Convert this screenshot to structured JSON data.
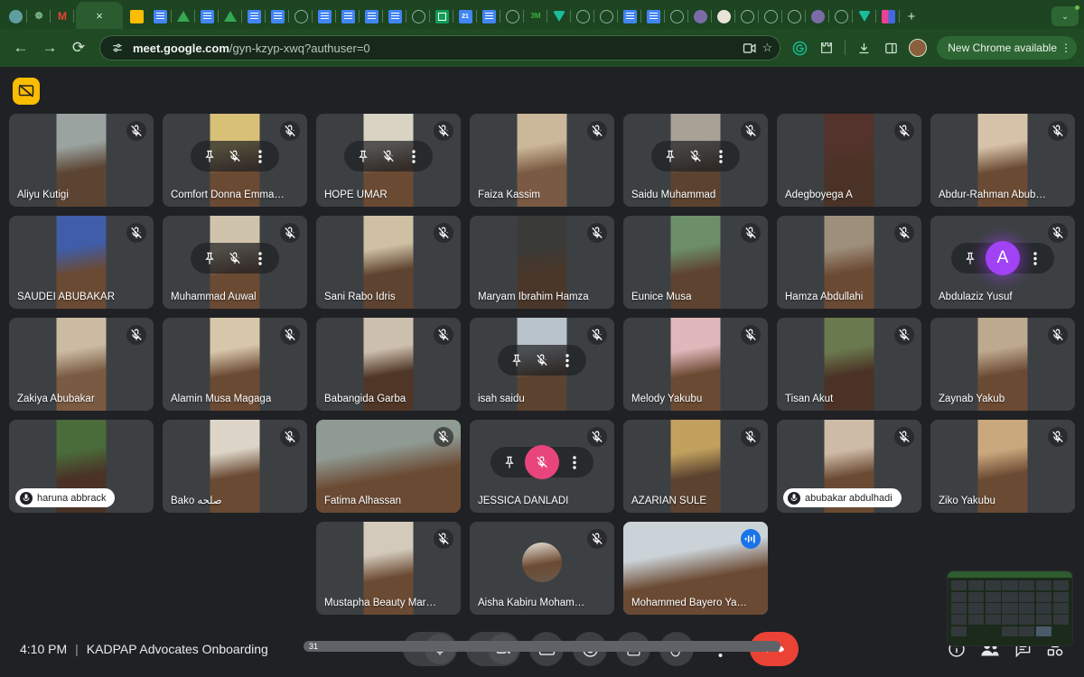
{
  "browser": {
    "url_domain": "meet.google.com",
    "url_path": "/gyn-kzyp-xwq?authuser=0",
    "tab_close_label": "×",
    "new_tab_label": "+",
    "back_label": "←",
    "forward_label": "→",
    "reload_label": "⟳",
    "update_chip_label": "New Chrome available",
    "update_chip_menu": "⋮",
    "tabs": [
      {
        "name": "tab-favicon-blue-diamond",
        "kind": "fv-blue-circle"
      },
      {
        "name": "tab-favicon-shield",
        "kind": "fv-shield",
        "glyph": "☸"
      },
      {
        "name": "tab-favicon-gmail",
        "kind": "fv-gmail",
        "glyph": "M"
      },
      {
        "name": "tab-favicon-meet",
        "kind": "fv-meet"
      },
      {
        "name": "tab-favicon-docs-1",
        "kind": "fv-doc"
      },
      {
        "name": "tab-favicon-drive-1",
        "kind": "fv-drive"
      },
      {
        "name": "tab-favicon-docs-2",
        "kind": "fv-doc"
      },
      {
        "name": "tab-favicon-drive-2",
        "kind": "fv-drive"
      },
      {
        "name": "tab-favicon-docs-3",
        "kind": "fv-doc"
      },
      {
        "name": "tab-favicon-docs-4",
        "kind": "fv-doc"
      },
      {
        "name": "tab-favicon-circle-1",
        "kind": "fv-circle"
      },
      {
        "name": "tab-favicon-docs-5",
        "kind": "fv-doc"
      },
      {
        "name": "tab-favicon-docs-6",
        "kind": "fv-doc"
      },
      {
        "name": "tab-favicon-docs-7",
        "kind": "fv-doc"
      },
      {
        "name": "tab-favicon-docs-8",
        "kind": "fv-doc"
      },
      {
        "name": "tab-favicon-circle-2",
        "kind": "fv-circle"
      },
      {
        "name": "tab-favicon-sheets",
        "kind": "fv-sheet"
      },
      {
        "name": "tab-favicon-calendar",
        "kind": "fv-cal",
        "glyph": "21"
      },
      {
        "name": "tab-favicon-docs-9",
        "kind": "fv-doc"
      },
      {
        "name": "tab-favicon-circle-3",
        "kind": "fv-circle"
      },
      {
        "name": "tab-favicon-3m",
        "kind": "fv-3m",
        "glyph": "3M"
      },
      {
        "name": "tab-favicon-tri-teal",
        "kind": "fv-tri-teal"
      },
      {
        "name": "tab-favicon-circle-4",
        "kind": "fv-circle"
      },
      {
        "name": "tab-favicon-circle-5",
        "kind": "fv-circle"
      },
      {
        "name": "tab-favicon-docs-10",
        "kind": "fv-doc"
      },
      {
        "name": "tab-favicon-docs-11",
        "kind": "fv-doc"
      },
      {
        "name": "tab-favicon-circle-6",
        "kind": "fv-circle"
      },
      {
        "name": "tab-favicon-purple-1",
        "kind": "fv-purple"
      },
      {
        "name": "tab-favicon-white-circle",
        "kind": "fv-white-circle"
      },
      {
        "name": "tab-favicon-circle-7",
        "kind": "fv-circle"
      },
      {
        "name": "tab-favicon-circle-8",
        "kind": "fv-circle"
      },
      {
        "name": "tab-favicon-circle-9",
        "kind": "fv-circle"
      },
      {
        "name": "tab-favicon-purple-2",
        "kind": "fv-purple"
      },
      {
        "name": "tab-favicon-circle-10",
        "kind": "fv-circle"
      },
      {
        "name": "tab-favicon-tri-teal-2",
        "kind": "fv-tri-teal"
      },
      {
        "name": "tab-favicon-pink",
        "kind": "fv-pink"
      }
    ]
  },
  "meet": {
    "present_button_icon": "stop-presenting-icon",
    "time": "4:10 PM",
    "separator": "|",
    "meeting_name": "KADPAP Advocates Onboarding",
    "participant_count": "31",
    "controls": [
      {
        "name": "microphone-toggle",
        "icon": "mic-icon",
        "chevron": "⌃"
      },
      {
        "name": "camera-toggle",
        "icon": "camera-icon",
        "chevron": "⌃"
      },
      {
        "name": "captions-toggle",
        "icon": "cc-icon"
      },
      {
        "name": "reactions-button",
        "icon": "emoji-icon"
      },
      {
        "name": "present-now-button",
        "icon": "present-icon"
      },
      {
        "name": "raise-hand-button",
        "icon": "hand-icon"
      },
      {
        "name": "more-options-button",
        "icon": "kebab-icon"
      },
      {
        "name": "end-call-button",
        "icon": "phone-hangup-icon"
      }
    ],
    "right_controls": [
      {
        "name": "meeting-details-button",
        "icon": "info-icon"
      },
      {
        "name": "people-panel-button",
        "icon": "people-icon"
      },
      {
        "name": "chat-panel-button",
        "icon": "chat-icon"
      },
      {
        "name": "activities-button",
        "icon": "activities-icon"
      }
    ],
    "rows": [
      [
        {
          "name": "Aliyu Kutigi",
          "muted": true,
          "hover": false,
          "video": "portrait",
          "bg": "#9aa3a0",
          "skin": "#5c4433"
        },
        {
          "name": "Comfort Donna Emma…",
          "muted": true,
          "hover": true,
          "video": "portrait",
          "bg": "#d8c077",
          "skin": "#6b4a33"
        },
        {
          "name": "HOPE UMAR",
          "muted": true,
          "hover": true,
          "video": "portrait",
          "bg": "#d9d3c4",
          "skin": "#6b4a33"
        },
        {
          "name": "Faiza Kassim",
          "muted": true,
          "hover": false,
          "video": "portrait",
          "bg": "#cbb79a",
          "skin": "#7a5a42"
        },
        {
          "name": "Saidu Muhammad",
          "muted": true,
          "hover": true,
          "video": "portrait",
          "bg": "#a8a196",
          "skin": "#5b4330"
        },
        {
          "name": "Adegboyega A",
          "muted": true,
          "hover": false,
          "video": "portrait",
          "bg": "#53332b",
          "skin": "#4a3226"
        },
        {
          "name": "Abdur-Rahman Abub…",
          "muted": true,
          "hover": false,
          "video": "portrait",
          "bg": "#d6c2a8",
          "skin": "#6b4a33"
        }
      ],
      [
        {
          "name": "SAUDEI ABUBAKAR",
          "muted": true,
          "hover": false,
          "video": "portrait",
          "bg": "#3f5da8",
          "skin": "#6b4a33"
        },
        {
          "name": "Muhammad Auwal",
          "muted": true,
          "hover": true,
          "video": "portrait",
          "bg": "#cfc3ab",
          "skin": "#6b4a33"
        },
        {
          "name": "Sani Rabo Idris",
          "muted": true,
          "hover": false,
          "video": "portrait",
          "bg": "#cfc0a4",
          "skin": "#5e4330"
        },
        {
          "name": "Maryam Ibrahim Hamza",
          "muted": true,
          "hover": false,
          "video": "portrait",
          "bg": "#3a3a38",
          "skin": "#4a372a"
        },
        {
          "name": "Eunice Musa",
          "muted": true,
          "hover": false,
          "video": "portrait",
          "bg": "#6c8f6a",
          "skin": "#5e4330"
        },
        {
          "name": "Hamza Abdullahi",
          "muted": true,
          "hover": false,
          "video": "portrait",
          "bg": "#9e8f7c",
          "skin": "#6b4a33"
        },
        {
          "name": "Abdulaziz Yusuf",
          "muted": true,
          "hover": true,
          "avatar_letter": "A",
          "avatar_color": "#a142f4"
        }
      ],
      [
        {
          "name": "Zakiya Abubakar",
          "muted": true,
          "hover": false,
          "video": "portrait",
          "bg": "#cbbba3",
          "skin": "#7a5a42"
        },
        {
          "name": "Alamin Musa Magaga",
          "muted": true,
          "hover": false,
          "video": "portrait",
          "bg": "#d7c6a9",
          "skin": "#6b4a33"
        },
        {
          "name": "Babangida Garba",
          "muted": true,
          "hover": false,
          "video": "portrait",
          "bg": "#cdbfae",
          "skin": "#4f3626"
        },
        {
          "name": "isah saidu",
          "muted": true,
          "hover": true,
          "video": "portrait",
          "bg": "#b9c3cc",
          "skin": "#5b4330"
        },
        {
          "name": "Melody Yakubu",
          "muted": true,
          "hover": false,
          "video": "portrait",
          "bg": "#e0b7bb",
          "skin": "#6b4a33"
        },
        {
          "name": "Tisan Akut",
          "muted": true,
          "hover": false,
          "video": "portrait",
          "bg": "#6b7a4e",
          "skin": "#4a3226"
        },
        {
          "name": "Zaynab Yakub",
          "muted": true,
          "hover": false,
          "video": "portrait",
          "bg": "#bda98d",
          "skin": "#6b4a33"
        }
      ],
      [
        {
          "name": "haruna abbrack",
          "muted": false,
          "hover": false,
          "video": "portrait",
          "bg": "#4a6b3a",
          "skin": "#4a3226",
          "pill": true
        },
        {
          "name": "Bako صلحه",
          "muted": true,
          "hover": false,
          "video": "portrait",
          "bg": "#ddd6c8",
          "skin": "#6b4a33"
        },
        {
          "name": "Fatima Alhassan",
          "muted": true,
          "hover": false,
          "video": "wide",
          "bg": "#8f9a93",
          "skin": "#6b4a33"
        },
        {
          "name": "JESSICA DANLADI",
          "muted": true,
          "hover": true,
          "avatar_letter": "",
          "avatar_color": "#e8457c"
        },
        {
          "name": "AZARIAN SULE",
          "muted": true,
          "hover": false,
          "video": "portrait",
          "bg": "#c2a15e",
          "skin": "#5b4330"
        },
        {
          "name": "abubakar abdulhadi",
          "muted": true,
          "hover": false,
          "video": "portrait",
          "bg": "#cdbba6",
          "skin": "#6b4a33",
          "pill": true
        },
        {
          "name": "Ziko Yakubu",
          "muted": true,
          "hover": false,
          "video": "portrait",
          "bg": "#caa87e",
          "skin": "#6b4a33"
        }
      ],
      [
        {
          "name": "Mustapha Beauty Mar…",
          "muted": true,
          "hover": false,
          "video": "portrait",
          "bg": "#d3cabb",
          "skin": "#6b4a33"
        },
        {
          "name": "Aisha Kabiru Moham…",
          "muted": true,
          "hover": false,
          "video": "avatar-photo",
          "bg": "#e8e0d4",
          "skin": "#6b4a33"
        },
        {
          "name": "Mohammed Bayero Ya…",
          "muted": false,
          "hover": false,
          "video": "wide",
          "bg": "#cbd3d8",
          "skin": "#6b4a33",
          "active": true,
          "speaking": true
        }
      ]
    ]
  }
}
